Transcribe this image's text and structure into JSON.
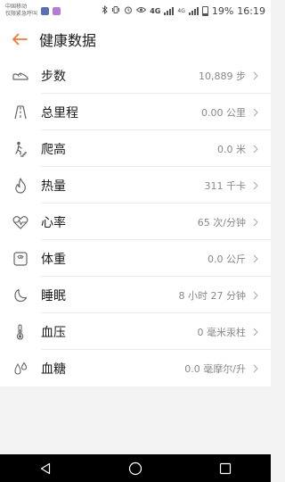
{
  "status_bar": {
    "carrier_line1": "中国移动",
    "carrier_line2": "仅限紧急呼叫",
    "network": "4G",
    "network2": "4G",
    "battery": "19%",
    "time": "16:19",
    "app_icon_colors": [
      "#5b6fb5",
      "#b57bd6"
    ]
  },
  "app_bar": {
    "title": "健康数据",
    "accent_color": "#f07a3a"
  },
  "health_items": [
    {
      "icon": "shoe-icon",
      "label": "步数",
      "value": "10,889 步"
    },
    {
      "icon": "road-icon",
      "label": "总里程",
      "value": "0.00 公里"
    },
    {
      "icon": "stairs-icon",
      "label": "爬高",
      "value": "0.0 米"
    },
    {
      "icon": "flame-icon",
      "label": "热量",
      "value": "311 千卡"
    },
    {
      "icon": "heart-rate-icon",
      "label": "心率",
      "value": "65 次/分钟"
    },
    {
      "icon": "scale-icon",
      "label": "体重",
      "value": "0.0 公斤"
    },
    {
      "icon": "moon-icon",
      "label": "睡眠",
      "value": "8 小时 27 分钟"
    },
    {
      "icon": "thermometer-icon",
      "label": "血压",
      "value": "0 毫米汞柱"
    },
    {
      "icon": "droplets-icon",
      "label": "血糖",
      "value": "0.0 毫摩尔/升"
    }
  ],
  "nav_bar": {
    "buttons": [
      "back-triangle-icon",
      "home-circle-icon",
      "recents-square-icon"
    ]
  }
}
